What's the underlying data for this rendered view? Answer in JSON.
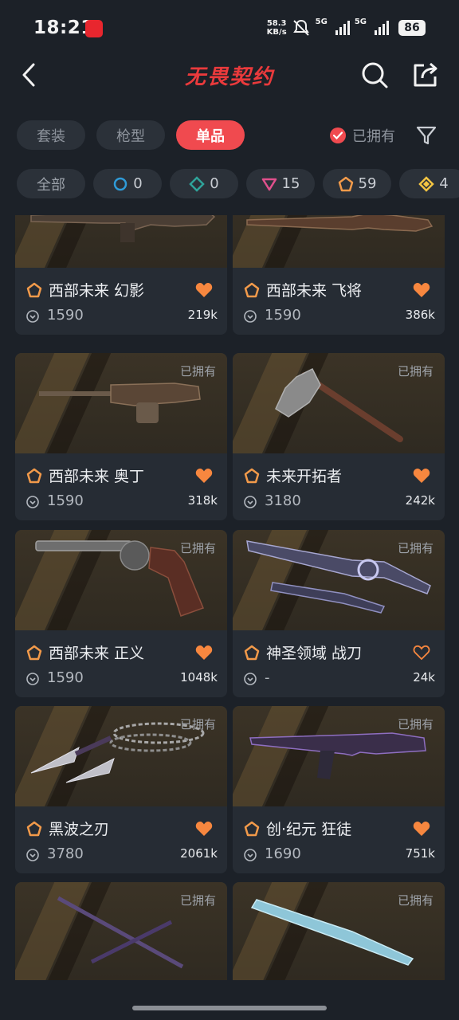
{
  "status_bar": {
    "time": "18:21",
    "net_speed_value": "58.3",
    "net_speed_unit": "KB/s",
    "signal1_label": "5G",
    "signal2_label": "5G",
    "battery": "86"
  },
  "header": {
    "title": "无畏契约"
  },
  "tabs": [
    {
      "label": "套装",
      "active": false
    },
    {
      "label": "枪型",
      "active": false
    },
    {
      "label": "单品",
      "active": true
    }
  ],
  "owned_filter": {
    "label": "已拥有",
    "checked": true
  },
  "tier_filters": [
    {
      "label": "全部",
      "icon": "none"
    },
    {
      "count": "0",
      "icon": "tier-select-icon",
      "color": "#2f9bd8"
    },
    {
      "count": "0",
      "icon": "tier-deluxe-icon",
      "color": "#2fa39a"
    },
    {
      "count": "15",
      "icon": "tier-premium-icon",
      "color": "#e0508c"
    },
    {
      "count": "59",
      "icon": "tier-exclusive-icon",
      "color": "#f29a4a"
    },
    {
      "count": "4",
      "icon": "tier-ultra-icon",
      "color": "#f4c542"
    }
  ],
  "colors": {
    "accent": "#f04a4f",
    "heart": "#f7873f",
    "tier_exclusive": "#f29a4a",
    "tier_ultra": "#f4c542",
    "background": "#1c2128",
    "card": "#262c34"
  },
  "items": [
    {
      "name": "西部未来 幻影",
      "price": "1590",
      "likes": "219k",
      "owned_label": "",
      "liked": true,
      "icon": "tier-exclusive-icon"
    },
    {
      "name": "西部未来 飞将",
      "price": "1590",
      "likes": "386k",
      "owned_label": "",
      "liked": true,
      "icon": "tier-exclusive-icon"
    },
    {
      "name": "西部未来 奥丁",
      "price": "1590",
      "likes": "318k",
      "owned_label": "已拥有",
      "liked": true,
      "icon": "tier-exclusive-icon"
    },
    {
      "name": "未来开拓者",
      "price": "3180",
      "likes": "242k",
      "owned_label": "已拥有",
      "liked": true,
      "icon": "tier-exclusive-icon"
    },
    {
      "name": "西部未来 正义",
      "price": "1590",
      "likes": "1048k",
      "owned_label": "已拥有",
      "liked": true,
      "icon": "tier-exclusive-icon"
    },
    {
      "name": "神圣领域 战刀",
      "price": "-",
      "likes": "24k",
      "owned_label": "已拥有",
      "liked": false,
      "icon": "tier-exclusive-icon"
    },
    {
      "name": "黑波之刃",
      "price": "3780",
      "likes": "2061k",
      "owned_label": "已拥有",
      "liked": true,
      "icon": "tier-exclusive-icon"
    },
    {
      "name": "创·纪元 狂徒",
      "price": "1690",
      "likes": "751k",
      "owned_label": "已拥有",
      "liked": true,
      "icon": "tier-exclusive-icon"
    },
    {
      "name": "",
      "price": "",
      "likes": "",
      "owned_label": "已拥有",
      "liked": false,
      "icon": "tier-exclusive-icon"
    },
    {
      "name": "",
      "price": "",
      "likes": "",
      "owned_label": "已拥有",
      "liked": false,
      "icon": "tier-exclusive-icon"
    }
  ]
}
